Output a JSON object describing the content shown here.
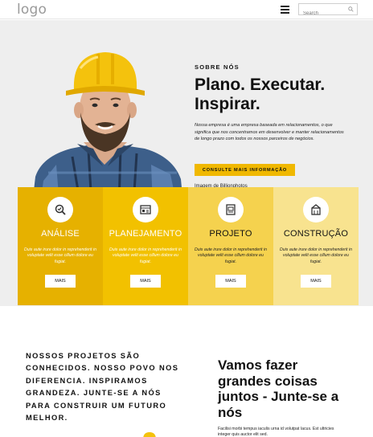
{
  "header": {
    "logo": "logo",
    "search_placeholder": "Search"
  },
  "hero": {
    "eyebrow": "SOBRE NÓS",
    "headline": "Plano. Executar. Inspirar.",
    "intro": "Nossa empresa é uma empresa baseada em relacionamentos, o que significa que nos concentramos em desenvolver e manter relacionamentos de longo prazo com todos os nossos parceiros de negócios.",
    "cta_label": "CONSULTE MAIS INFORMAÇÃO",
    "credit_prefix": "Imagem de ",
    "credit_link": "Billionphotos"
  },
  "services": [
    {
      "title": "ANÁLISE",
      "desc": "Duis aute irure dolor in reprehenderit in voluptate velit esse cillum dolore eu fugiat.",
      "button": "MAIS",
      "bg": "#e6b100",
      "icon": "analysis-icon"
    },
    {
      "title": "PLANEJAMENTO",
      "desc": "Duis aute irure dolor in reprehenderit in voluptate velit esse cillum dolore eu fugiat.",
      "button": "MAIS",
      "bg": "#f2c100",
      "icon": "planning-icon"
    },
    {
      "title": "PROJETO",
      "desc": "Duis aute irure dolor in reprehenderit in voluptate velit esse cillum dolore eu fugiat.",
      "button": "MAIS",
      "bg": "#f5d24e",
      "icon": "blueprint-icon"
    },
    {
      "title": "CONSTRUÇÃO",
      "desc": "Duis aute irure dolor in reprehenderit in voluptate velit esse cillum dolore eu fugiat.",
      "button": "MAIS",
      "bg": "#f8e38f",
      "icon": "construction-icon"
    }
  ],
  "lower": {
    "left_text": "NOSSOS PROJETOS SÃO CONHECIDOS. NOSSO POVO NOS DIFERENCIA. INSPIRAMOS GRANDEZA. JUNTE-SE A NÓS PARA CONSTRUIR UM FUTURO MELHOR.",
    "right_title": "Vamos fazer grandes coisas juntos - Junte-se a nós",
    "right_body": "Facilisi morbi tempus iaculis urna id volutpat lacus. Est ultricies integer quis auctor elit sed."
  },
  "colors": {
    "accent": "#f0b800",
    "hero_bg": "#eeeeee"
  }
}
